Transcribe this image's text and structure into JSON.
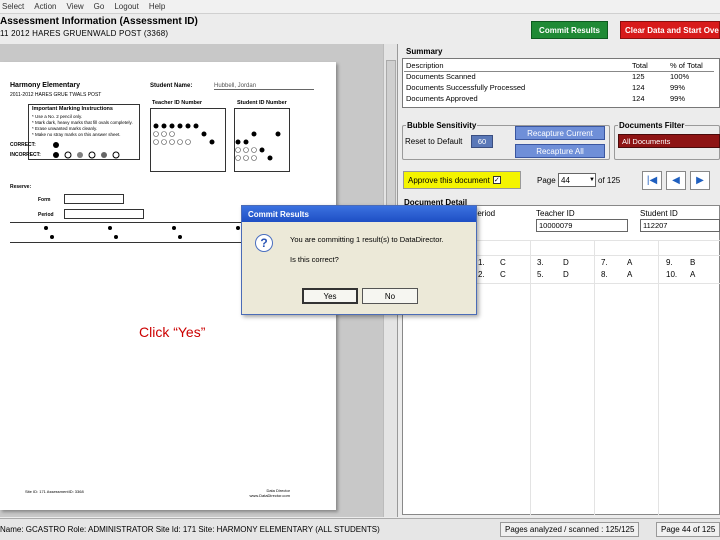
{
  "menu": [
    "Select",
    "Action",
    "View",
    "Go",
    "Logout",
    "Help"
  ],
  "app": {
    "title": "Assessment Information (Assessment ID)",
    "subtitle": "11 2012 HARES GRUENWALD POST (3368)"
  },
  "scan": {
    "school": "Harmony Elementary",
    "test_line": "2011-2012 HARES GRUE TWALS POST",
    "student_label": "Student Name:",
    "student_value": "Hubbell, Jordan",
    "instructions_title": "Important Marking Instructions",
    "instructions": [
      "* Use a No. 2 pencil only.",
      "* Mark dark, heavy marks that fill ovals completely.",
      "* Erase unwanted marks cleanly.",
      "* Make no stray marks on this answer sheet."
    ],
    "correct_label": "CORRECT:",
    "incorrect_label": "INCORRECT:",
    "teacher_id_label": "Teacher ID Number",
    "student_id_label": "Student ID Number",
    "reserve_label": "Reserve:",
    "form_label": "Form",
    "period_label": "Period",
    "footer_left": "Site ID: 171   AssessmentID: 3368",
    "footer_right": "Data Director www.DataDirector.com"
  },
  "annotation": "Click “Yes”",
  "toolbar": {
    "commit_label": "Commit Results",
    "clear_label": "Clear Data and Start Over"
  },
  "summary": {
    "title": "Summary",
    "columns": [
      "Description",
      "Total",
      "% of Total"
    ],
    "rows": [
      [
        "Documents Scanned",
        "125",
        "100%"
      ],
      [
        "Documents Successfully Processed",
        "124",
        "99%"
      ],
      [
        "Documents Approved",
        "124",
        "99%"
      ]
    ]
  },
  "bubble": {
    "title": "Bubble Sensitivity",
    "reset_label": "Reset to Default",
    "value": "60",
    "recapture_current": "Recapture Current",
    "recapture_all": "Recapture All"
  },
  "filter": {
    "title": "Documents Filter",
    "selected": "All Documents"
  },
  "approve_label": "Approve this document",
  "paging": {
    "page_label": "Page",
    "current": "44",
    "of_text": "of  125"
  },
  "detail": {
    "title": "Document Detail",
    "col_period": "Period",
    "col_teacher": "Teacher ID",
    "col_student": "Student ID",
    "teacher_value": "10000079",
    "student_value": "112207",
    "answers_row1": [
      "1.",
      "C",
      "3.",
      "D",
      "7.",
      "A",
      "9.",
      "B"
    ],
    "answers_row2": [
      "2.",
      "C",
      "5.",
      "D",
      "8.",
      "A",
      "10.",
      "A"
    ]
  },
  "dialog": {
    "title": "Commit Results",
    "message1": "You are committing 1 result(s) to DataDirector.",
    "message2": "Is this correct?",
    "yes": "Yes",
    "no": "No"
  },
  "status": {
    "left": "Name: GCASTRO  Role: ADMINISTRATOR  Site Id: 171  Site: HARMONY ELEMENTARY (ALL STUDENTS)",
    "pages": "Pages analyzed / scanned : 125/125",
    "page_of": "Page 44 of 125"
  }
}
